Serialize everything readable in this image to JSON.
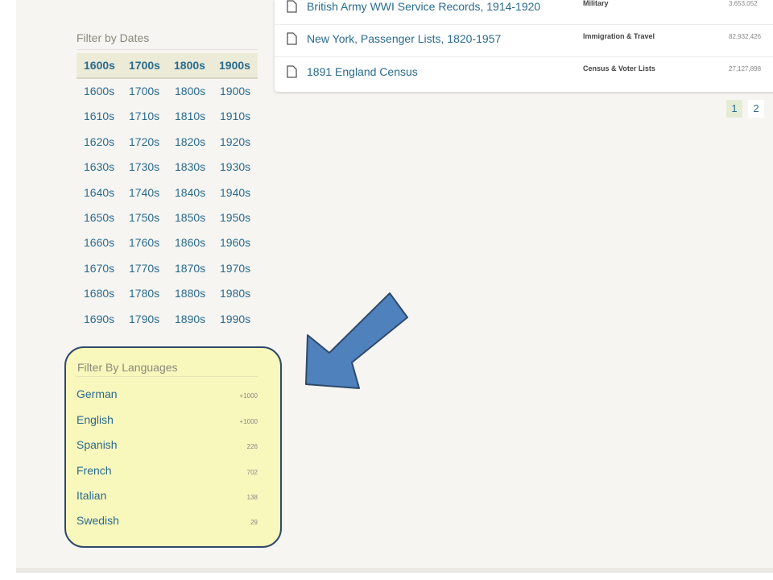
{
  "results": [
    {
      "title": "British Army WWI Service Records, 1914-1920",
      "category": "Military",
      "count": "3,653,052"
    },
    {
      "title": "New York, Passenger Lists, 1820-1957",
      "category": "Immigration & Travel",
      "count": "82,932,426"
    },
    {
      "title": "1891 England Census",
      "category": "Census & Voter Lists",
      "count": "27,127,898"
    }
  ],
  "pagination": {
    "pages": [
      "1",
      "2"
    ],
    "active": "1"
  },
  "date_filter": {
    "heading": "Filter by Dates",
    "centuries": [
      "1600s",
      "1700s",
      "1800s",
      "1900s"
    ],
    "decades": [
      [
        "1600s",
        "1700s",
        "1800s",
        "1900s"
      ],
      [
        "1610s",
        "1710s",
        "1810s",
        "1910s"
      ],
      [
        "1620s",
        "1720s",
        "1820s",
        "1920s"
      ],
      [
        "1630s",
        "1730s",
        "1830s",
        "1930s"
      ],
      [
        "1640s",
        "1740s",
        "1840s",
        "1940s"
      ],
      [
        "1650s",
        "1750s",
        "1850s",
        "1950s"
      ],
      [
        "1660s",
        "1760s",
        "1860s",
        "1960s"
      ],
      [
        "1670s",
        "1770s",
        "1870s",
        "1970s"
      ],
      [
        "1680s",
        "1780s",
        "1880s",
        "1980s"
      ],
      [
        "1690s",
        "1790s",
        "1890s",
        "1990s"
      ]
    ]
  },
  "language_filter": {
    "heading": "Filter By Languages",
    "items": [
      {
        "name": "German",
        "count": "+1000"
      },
      {
        "name": "English",
        "count": "+1000"
      },
      {
        "name": "Spanish",
        "count": "226"
      },
      {
        "name": "French",
        "count": "702"
      },
      {
        "name": "Italian",
        "count": "138"
      },
      {
        "name": "Swedish",
        "count": "29"
      }
    ]
  },
  "colors": {
    "link": "#2a6b8e",
    "highlight_fill": "#f8f7bc",
    "highlight_border": "#2f4a6b",
    "arrow_fill": "#4f81bd",
    "arrow_stroke": "#2f4a6b"
  }
}
